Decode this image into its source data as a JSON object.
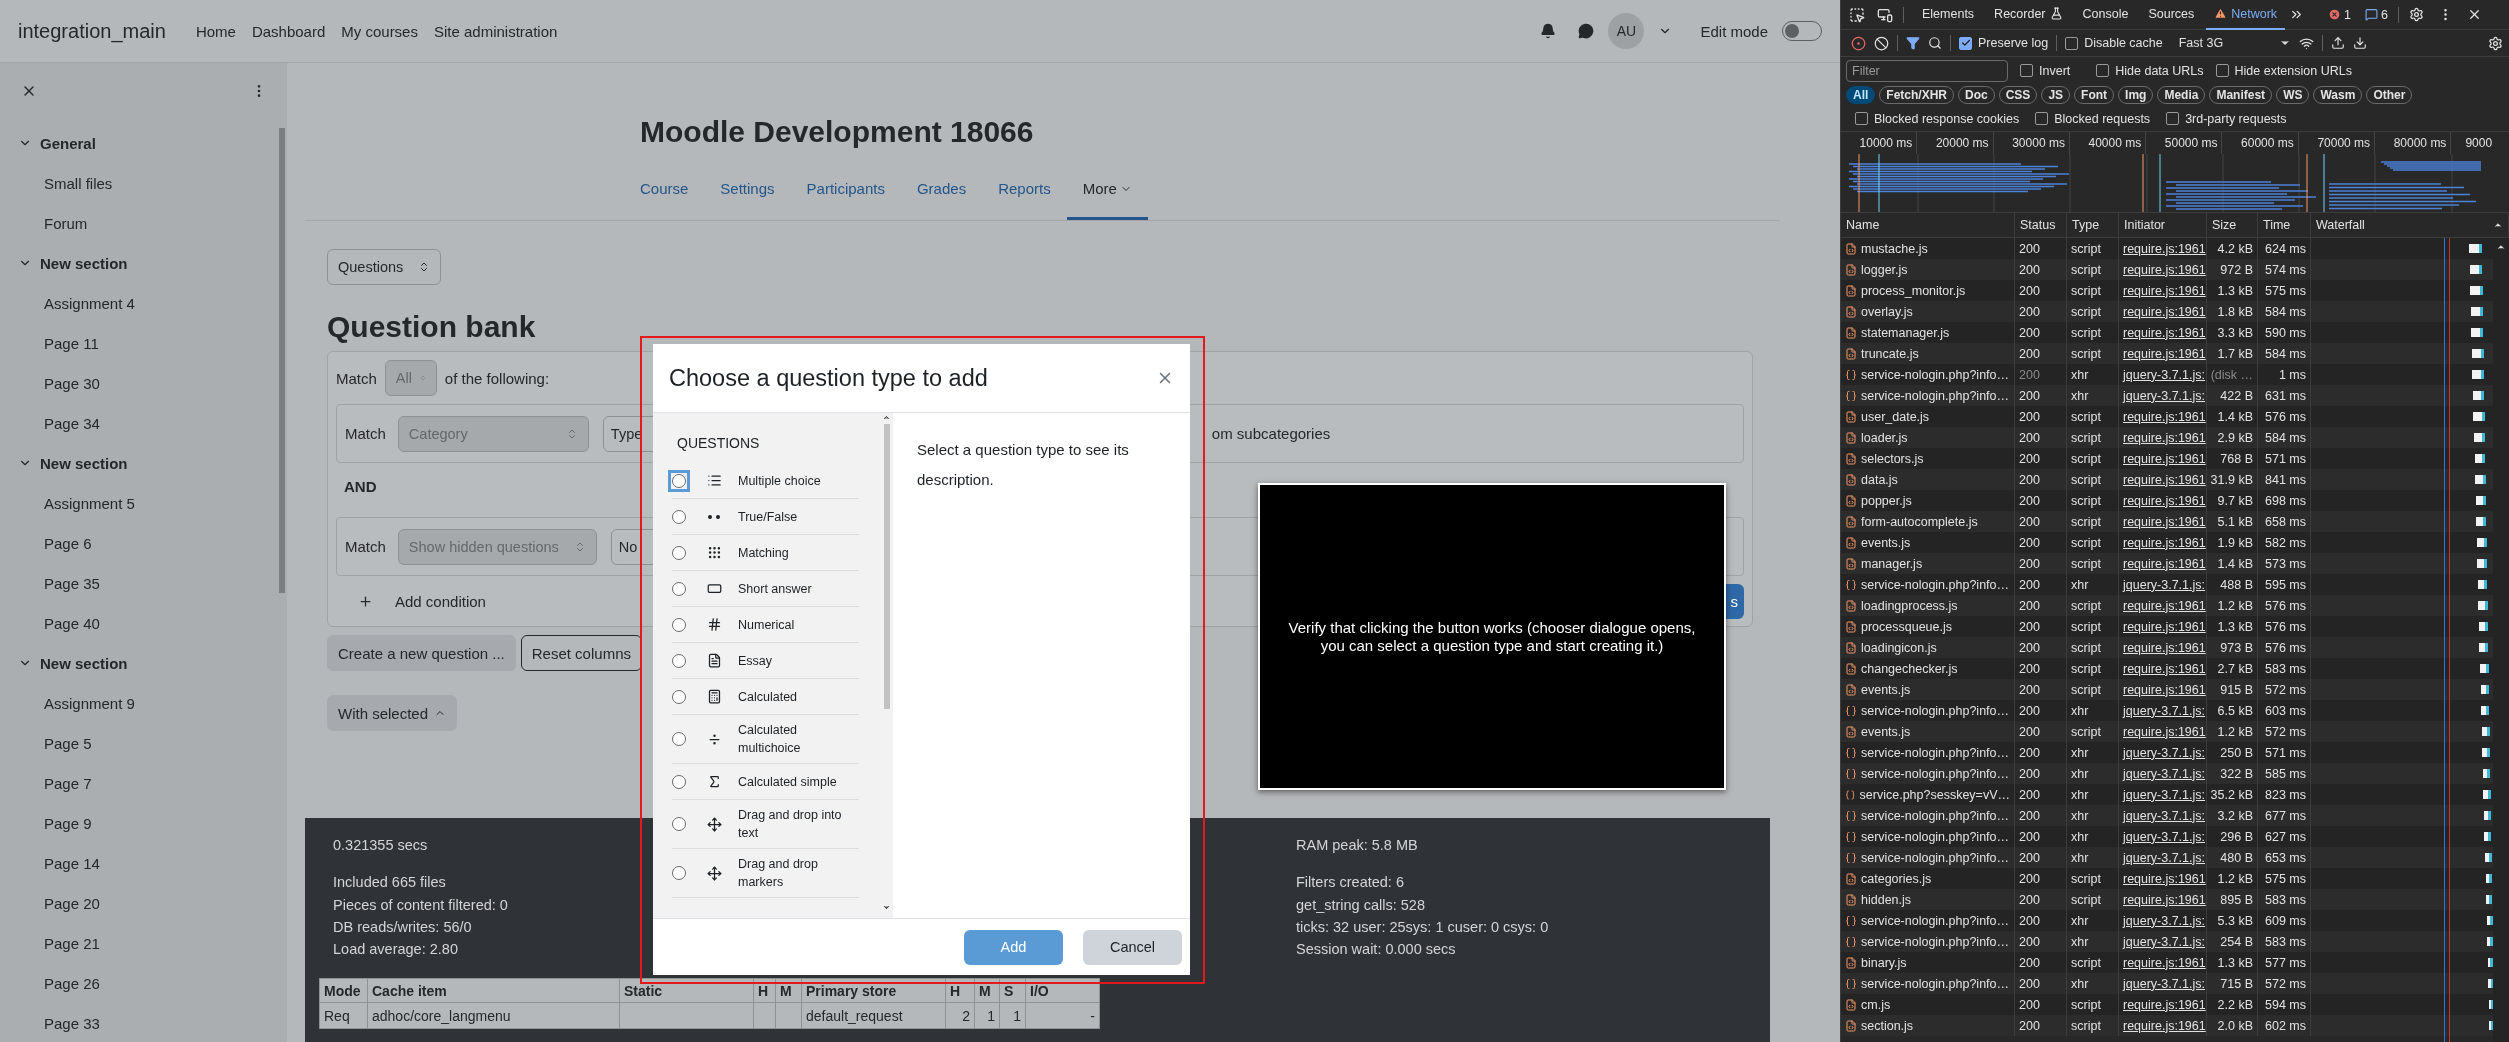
{
  "header": {
    "site_name": "integration_main",
    "nav": [
      "Home",
      "Dashboard",
      "My courses",
      "Site administration"
    ],
    "avatar": "AU",
    "edit_mode": {
      "label": "Edit mode",
      "on": false
    }
  },
  "sidebar": {
    "sections": [
      {
        "title": "General",
        "expanded": true,
        "items": [
          "Small files",
          "Forum"
        ]
      },
      {
        "title": "New section",
        "expanded": true,
        "items": [
          "Assignment 4",
          "Page 11",
          "Page 30",
          "Page 34"
        ]
      },
      {
        "title": "New section",
        "expanded": true,
        "items": [
          "Assignment 5",
          "Page 6",
          "Page 35",
          "Page 40"
        ]
      },
      {
        "title": "New section",
        "expanded": true,
        "items": [
          "Assignment 9",
          "Page 5",
          "Page 7",
          "Page 9",
          "Page 14",
          "Page 20",
          "Page 21",
          "Page 26",
          "Page 33"
        ]
      }
    ]
  },
  "course": {
    "title": "Moodle Development 18066",
    "tabs": [
      {
        "label": "Course",
        "selected": false,
        "menu": false
      },
      {
        "label": "Settings",
        "selected": false,
        "menu": false
      },
      {
        "label": "Participants",
        "selected": false,
        "menu": false
      },
      {
        "label": "Grades",
        "selected": false,
        "menu": false
      },
      {
        "label": "Reports",
        "selected": false,
        "menu": false
      },
      {
        "label": "More",
        "selected": true,
        "menu": true
      }
    ]
  },
  "page_select": "Questions",
  "bank": {
    "title": "Question bank",
    "match": {
      "label": "Match",
      "value": "All",
      "suffix": "of the following:"
    },
    "conditions": [
      {
        "label": "Match",
        "field": "Category",
        "value": "Type",
        "extra": "om subcategories"
      },
      {
        "label": "Match",
        "field": "Show hidden questions",
        "value": "No"
      }
    ],
    "joiner": "AND",
    "add_condition": "Add condition",
    "apply": "s"
  },
  "actions": {
    "create": "Create a new question ...",
    "reset": "Reset columns",
    "with_selected": "With selected"
  },
  "perf": {
    "time": "0.321355 secs",
    "left": [
      "Included 665 files",
      "Pieces of content filtered: 0",
      "DB reads/writes: 56/0",
      "Load average: 2.80"
    ],
    "ram": "RAM peak: 5.8 MB",
    "right": [
      "Filters created: 6",
      "get_string calls: 528",
      "ticks: 32 user: 25sys: 1 cuser: 0 csys: 0",
      "Session wait: 0.000 secs"
    ]
  },
  "cache_table": {
    "columns": [
      "Mode",
      "Cache item",
      "Static",
      "H",
      "M",
      "Primary store",
      "H",
      "M",
      "S",
      "I/O"
    ],
    "rows": [
      [
        "Req",
        "adhoc/core_langmenu",
        null,
        null,
        null,
        "default_request",
        "2",
        "1",
        "1",
        "-"
      ]
    ]
  },
  "modal": {
    "title": "Choose a question type to add",
    "section": "QUESTIONS",
    "types": [
      {
        "label": "Multiple choice",
        "selected": false,
        "focused": true
      },
      {
        "label": "True/False",
        "selected": false,
        "focused": false
      },
      {
        "label": "Matching",
        "selected": false,
        "focused": false
      },
      {
        "label": "Short answer",
        "selected": false,
        "focused": false
      },
      {
        "label": "Numerical",
        "selected": false,
        "focused": false
      },
      {
        "label": "Essay",
        "selected": false,
        "focused": false
      },
      {
        "label": "Calculated",
        "selected": false,
        "focused": false
      },
      {
        "label": "Calculated multichoice",
        "selected": false,
        "focused": false
      },
      {
        "label": "Calculated simple",
        "selected": false,
        "focused": false
      },
      {
        "label": "Drag and drop into text",
        "selected": false,
        "focused": false
      },
      {
        "label": "Drag and drop markers",
        "selected": false,
        "focused": false
      }
    ],
    "description": "Select a question type to see its description.",
    "buttons": [
      {
        "label": "Add",
        "kind": "primary",
        "disabled": true
      },
      {
        "label": "Cancel",
        "kind": "secondary",
        "disabled": false
      }
    ]
  },
  "instruction": "Verify that clicking the button works (chooser dialogue opens, you can select a question type and start creating it.)",
  "devtools": {
    "tabs": [
      {
        "label": "Elements",
        "selected": false,
        "warning": false,
        "experimental": false
      },
      {
        "label": "Recorder",
        "selected": false,
        "warning": false,
        "experimental": true
      },
      {
        "label": "Console",
        "selected": false,
        "warning": false,
        "experimental": false
      },
      {
        "label": "Sources",
        "selected": false,
        "warning": false,
        "experimental": false
      },
      {
        "label": "Network",
        "selected": true,
        "warning": true,
        "experimental": false
      }
    ],
    "errors": "1",
    "messages": "6",
    "preserve_log": {
      "label": "Preserve log",
      "checked": true
    },
    "disable_cache": {
      "label": "Disable cache",
      "checked": false
    },
    "throttling": "Fast 3G",
    "filter_placeholder": "Filter",
    "filter_options": [
      {
        "label": "Invert",
        "checked": false
      },
      {
        "label": "Hide data URLs",
        "checked": false
      },
      {
        "label": "Hide extension URLs",
        "checked": false
      }
    ],
    "types": [
      {
        "label": "All",
        "selected": true
      },
      {
        "label": "Fetch/XHR",
        "selected": false
      },
      {
        "label": "Doc",
        "selected": false
      },
      {
        "label": "CSS",
        "selected": false
      },
      {
        "label": "JS",
        "selected": false
      },
      {
        "label": "Font",
        "selected": false
      },
      {
        "label": "Img",
        "selected": false
      },
      {
        "label": "Media",
        "selected": false
      },
      {
        "label": "Manifest",
        "selected": false
      },
      {
        "label": "WS",
        "selected": false
      },
      {
        "label": "Wasm",
        "selected": false
      },
      {
        "label": "Other",
        "selected": false
      }
    ],
    "blocked": [
      {
        "label": "Blocked response cookies",
        "checked": false
      },
      {
        "label": "Blocked requests",
        "checked": false
      },
      {
        "label": "3rd-party requests",
        "checked": false
      }
    ],
    "timeline_ticks": [
      "10000 ms",
      "20000 ms",
      "30000 ms",
      "40000 ms",
      "50000 ms",
      "60000 ms",
      "70000 ms",
      "80000 ms",
      "9000"
    ],
    "columns": [
      "Name",
      "Status",
      "Type",
      "Initiator",
      "Size",
      "Time",
      "Waterfall"
    ],
    "rows": [
      {
        "name": "mustache.js",
        "status": "200",
        "type": "script",
        "initiator": "require.js:1961",
        "size": "4.2 kB",
        "time": "624 ms",
        "kind": "script",
        "cached": false
      },
      {
        "name": "logger.js",
        "status": "200",
        "type": "script",
        "initiator": "require.js:1961",
        "size": "972 B",
        "time": "574 ms",
        "kind": "script",
        "cached": false
      },
      {
        "name": "process_monitor.js",
        "status": "200",
        "type": "script",
        "initiator": "require.js:1961",
        "size": "1.3 kB",
        "time": "575 ms",
        "kind": "script",
        "cached": false
      },
      {
        "name": "overlay.js",
        "status": "200",
        "type": "script",
        "initiator": "require.js:1961",
        "size": "1.8 kB",
        "time": "584 ms",
        "kind": "script",
        "cached": false
      },
      {
        "name": "statemanager.js",
        "status": "200",
        "type": "script",
        "initiator": "require.js:1961",
        "size": "3.3 kB",
        "time": "590 ms",
        "kind": "script",
        "cached": false
      },
      {
        "name": "truncate.js",
        "status": "200",
        "type": "script",
        "initiator": "require.js:1961",
        "size": "1.7 kB",
        "time": "584 ms",
        "kind": "script",
        "cached": false
      },
      {
        "name": "service-nologin.php?info…",
        "status": "200",
        "type": "xhr",
        "initiator": "jquery-3.7.1.js:",
        "size": "(disk …",
        "time": "1 ms",
        "kind": "xhr",
        "cached": true
      },
      {
        "name": "service-nologin.php?info…",
        "status": "200",
        "type": "xhr",
        "initiator": "jquery-3.7.1.js:",
        "size": "422 B",
        "time": "631 ms",
        "kind": "xhr",
        "cached": false
      },
      {
        "name": "user_date.js",
        "status": "200",
        "type": "script",
        "initiator": "require.js:1961",
        "size": "1.4 kB",
        "time": "576 ms",
        "kind": "script",
        "cached": false
      },
      {
        "name": "loader.js",
        "status": "200",
        "type": "script",
        "initiator": "require.js:1961",
        "size": "2.9 kB",
        "time": "584 ms",
        "kind": "script",
        "cached": false
      },
      {
        "name": "selectors.js",
        "status": "200",
        "type": "script",
        "initiator": "require.js:1961",
        "size": "768 B",
        "time": "571 ms",
        "kind": "script",
        "cached": false
      },
      {
        "name": "data.js",
        "status": "200",
        "type": "script",
        "initiator": "require.js:1961",
        "size": "31.9 kB",
        "time": "841 ms",
        "kind": "script",
        "cached": false
      },
      {
        "name": "popper.js",
        "status": "200",
        "type": "script",
        "initiator": "require.js:1961",
        "size": "9.7 kB",
        "time": "698 ms",
        "kind": "script",
        "cached": false
      },
      {
        "name": "form-autocomplete.js",
        "status": "200",
        "type": "script",
        "initiator": "require.js:1961",
        "size": "5.1 kB",
        "time": "658 ms",
        "kind": "script",
        "cached": false
      },
      {
        "name": "events.js",
        "status": "200",
        "type": "script",
        "initiator": "require.js:1961",
        "size": "1.9 kB",
        "time": "582 ms",
        "kind": "script",
        "cached": false
      },
      {
        "name": "manager.js",
        "status": "200",
        "type": "script",
        "initiator": "require.js:1961",
        "size": "1.4 kB",
        "time": "573 ms",
        "kind": "script",
        "cached": false
      },
      {
        "name": "service-nologin.php?info…",
        "status": "200",
        "type": "xhr",
        "initiator": "jquery-3.7.1.js:",
        "size": "488 B",
        "time": "595 ms",
        "kind": "xhr",
        "cached": false
      },
      {
        "name": "loadingprocess.js",
        "status": "200",
        "type": "script",
        "initiator": "require.js:1961",
        "size": "1.2 kB",
        "time": "576 ms",
        "kind": "script",
        "cached": false
      },
      {
        "name": "processqueue.js",
        "status": "200",
        "type": "script",
        "initiator": "require.js:1961",
        "size": "1.3 kB",
        "time": "576 ms",
        "kind": "script",
        "cached": false
      },
      {
        "name": "loadingicon.js",
        "status": "200",
        "type": "script",
        "initiator": "require.js:1961",
        "size": "973 B",
        "time": "576 ms",
        "kind": "script",
        "cached": false
      },
      {
        "name": "changechecker.js",
        "status": "200",
        "type": "script",
        "initiator": "require.js:1961",
        "size": "2.7 kB",
        "time": "583 ms",
        "kind": "script",
        "cached": false
      },
      {
        "name": "events.js",
        "status": "200",
        "type": "script",
        "initiator": "require.js:1961",
        "size": "915 B",
        "time": "572 ms",
        "kind": "script",
        "cached": false
      },
      {
        "name": "service-nologin.php?info…",
        "status": "200",
        "type": "xhr",
        "initiator": "jquery-3.7.1.js:",
        "size": "6.5 kB",
        "time": "603 ms",
        "kind": "xhr",
        "cached": false
      },
      {
        "name": "events.js",
        "status": "200",
        "type": "script",
        "initiator": "require.js:1961",
        "size": "1.2 kB",
        "time": "572 ms",
        "kind": "script",
        "cached": false
      },
      {
        "name": "service-nologin.php?info…",
        "status": "200",
        "type": "xhr",
        "initiator": "jquery-3.7.1.js:",
        "size": "250 B",
        "time": "571 ms",
        "kind": "xhr",
        "cached": false
      },
      {
        "name": "service-nologin.php?info…",
        "status": "200",
        "type": "xhr",
        "initiator": "jquery-3.7.1.js:",
        "size": "322 B",
        "time": "585 ms",
        "kind": "xhr",
        "cached": false
      },
      {
        "name": "service.php?sesskey=vV…",
        "status": "200",
        "type": "xhr",
        "initiator": "jquery-3.7.1.js:",
        "size": "35.2 kB",
        "time": "823 ms",
        "kind": "xhr",
        "cached": false
      },
      {
        "name": "service-nologin.php?info…",
        "status": "200",
        "type": "xhr",
        "initiator": "jquery-3.7.1.js:",
        "size": "3.2 kB",
        "time": "677 ms",
        "kind": "xhr",
        "cached": false
      },
      {
        "name": "service-nologin.php?info…",
        "status": "200",
        "type": "xhr",
        "initiator": "jquery-3.7.1.js:",
        "size": "296 B",
        "time": "627 ms",
        "kind": "xhr",
        "cached": false
      },
      {
        "name": "service-nologin.php?info…",
        "status": "200",
        "type": "xhr",
        "initiator": "jquery-3.7.1.js:",
        "size": "480 B",
        "time": "653 ms",
        "kind": "xhr",
        "cached": false
      },
      {
        "name": "categories.js",
        "status": "200",
        "type": "script",
        "initiator": "require.js:1961",
        "size": "1.2 kB",
        "time": "575 ms",
        "kind": "script",
        "cached": false
      },
      {
        "name": "hidden.js",
        "status": "200",
        "type": "script",
        "initiator": "require.js:1961",
        "size": "895 B",
        "time": "583 ms",
        "kind": "script",
        "cached": false
      },
      {
        "name": "service-nologin.php?info…",
        "status": "200",
        "type": "xhr",
        "initiator": "jquery-3.7.1.js:",
        "size": "5.3 kB",
        "time": "609 ms",
        "kind": "xhr",
        "cached": false
      },
      {
        "name": "service-nologin.php?info…",
        "status": "200",
        "type": "xhr",
        "initiator": "jquery-3.7.1.js:",
        "size": "254 B",
        "time": "583 ms",
        "kind": "xhr",
        "cached": false
      },
      {
        "name": "binary.js",
        "status": "200",
        "type": "script",
        "initiator": "require.js:1961",
        "size": "1.3 kB",
        "time": "577 ms",
        "kind": "script",
        "cached": false
      },
      {
        "name": "service-nologin.php?info…",
        "status": "200",
        "type": "xhr",
        "initiator": "jquery-3.7.1.js:",
        "size": "715 B",
        "time": "572 ms",
        "kind": "xhr",
        "cached": false
      },
      {
        "name": "cm.js",
        "status": "200",
        "type": "script",
        "initiator": "require.js:1961",
        "size": "2.2 kB",
        "time": "594 ms",
        "kind": "script",
        "cached": false
      },
      {
        "name": "section.js",
        "status": "200",
        "type": "script",
        "initiator": "require.js:1961",
        "size": "2.0 kB",
        "time": "602 ms",
        "kind": "script",
        "cached": false
      }
    ]
  }
}
